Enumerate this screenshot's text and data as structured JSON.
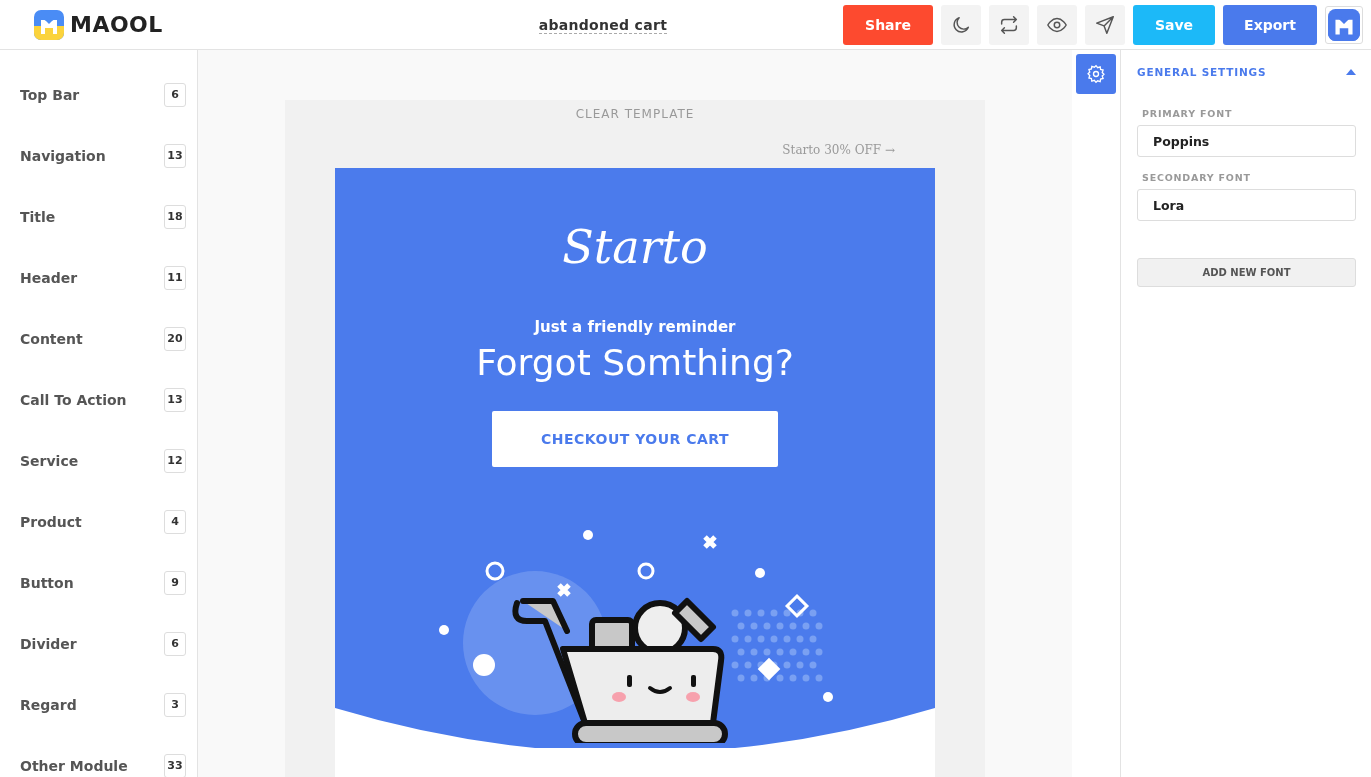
{
  "header": {
    "logo": "MAOOL",
    "document_title": "abandoned cart",
    "share": "Share",
    "save": "Save",
    "export": "Export"
  },
  "sidebar": {
    "items": [
      {
        "label": "Top Bar",
        "count": "6"
      },
      {
        "label": "Navigation",
        "count": "13"
      },
      {
        "label": "Title",
        "count": "18"
      },
      {
        "label": "Header",
        "count": "11"
      },
      {
        "label": "Content",
        "count": "20"
      },
      {
        "label": "Call To Action",
        "count": "13"
      },
      {
        "label": "Service",
        "count": "12"
      },
      {
        "label": "Product",
        "count": "4"
      },
      {
        "label": "Button",
        "count": "9"
      },
      {
        "label": "Divider",
        "count": "6"
      },
      {
        "label": "Regard",
        "count": "3"
      },
      {
        "label": "Other Module",
        "count": "33"
      }
    ]
  },
  "canvas": {
    "clear_template": "CLEAR TEMPLATE",
    "preheader_link": "Starto 30% OFF →",
    "email": {
      "brand": "Starto",
      "subtitle": "Just a friendly reminder",
      "headline": "Forgot Somthing?",
      "cta": "CHECKOUT YOUR CART"
    }
  },
  "settings": {
    "section_title": "GENERAL SETTINGS",
    "expanded": true,
    "fields": [
      {
        "label": "PRIMARY FONT",
        "value": "Poppins"
      },
      {
        "label": "SECONDARY FONT",
        "value": "Lora"
      }
    ],
    "add_button": "ADD NEW FONT"
  }
}
